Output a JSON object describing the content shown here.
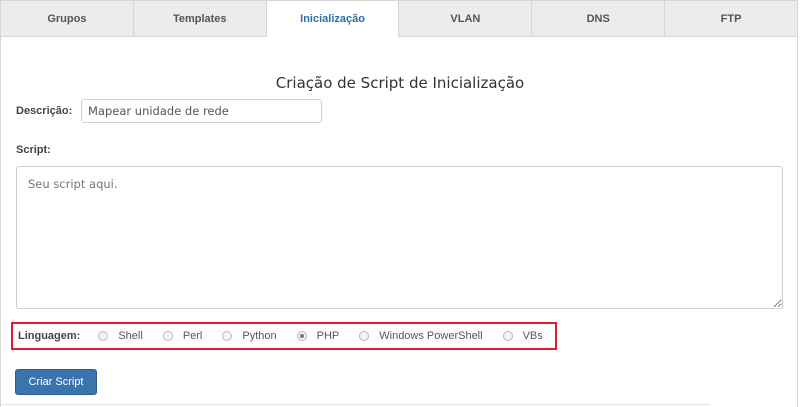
{
  "tabs": [
    {
      "label": "Grupos",
      "active": false
    },
    {
      "label": "Templates",
      "active": false
    },
    {
      "label": "Inicialização",
      "active": true
    },
    {
      "label": "VLAN",
      "active": false
    },
    {
      "label": "DNS",
      "active": false
    },
    {
      "label": "FTP",
      "active": false
    }
  ],
  "form": {
    "title": "Criação de Script de Inicialização",
    "description_label": "Descrição:",
    "description_value": "Mapear unidade de rede",
    "script_label": "Script:",
    "script_value": "Seu script aqui.",
    "language_label": "Linguagem:",
    "languages": [
      {
        "label": "Shell",
        "checked": false
      },
      {
        "label": "Perl",
        "checked": false
      },
      {
        "label": "Python",
        "checked": false
      },
      {
        "label": "PHP",
        "checked": true
      },
      {
        "label": "Windows PowerShell",
        "checked": false
      },
      {
        "label": "VBs",
        "checked": false
      }
    ],
    "submit_label": "Criar Script"
  },
  "colors": {
    "accent": "#2f6ea8",
    "button": "#3b73ad",
    "highlight_border": "#e0202a"
  }
}
